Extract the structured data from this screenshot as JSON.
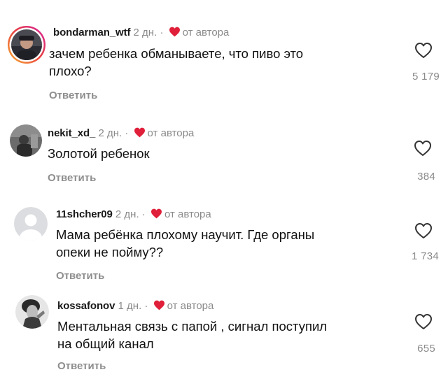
{
  "comments": [
    {
      "username": "bondarman_wtf",
      "time": "2 дн.",
      "separator": "·",
      "author_label": "от автора",
      "text": "зачем ребенка обманываете, что пиво это\nплохо?",
      "reply_label": "Ответить",
      "likes": "5 179"
    },
    {
      "username": "nekit_xd_",
      "time": "2 дн.",
      "separator": "·",
      "author_label": "от автора",
      "text": "Золотой ребенок",
      "reply_label": "Ответить",
      "likes": "384"
    },
    {
      "username": "11shcher09",
      "time": "2 дн.",
      "separator": "·",
      "author_label": "от автора",
      "text": "Мама ребёнка плохому научит.  Где органы\nопеки не пойму??",
      "reply_label": "Ответить",
      "likes": "1 734"
    },
    {
      "username": "kossafonov",
      "time": "1 дн.",
      "separator": "·",
      "author_label": "от автора",
      "text": "Ментальная связь с папой , сигнал поступил\nна общий канал",
      "reply_label": "Ответить",
      "likes": "655"
    }
  ],
  "colors": {
    "author_heart": "#e0203a",
    "muted_text": "#8a8a8a",
    "story_ring_start": "#f9b233",
    "story_ring_end": "#d6249f"
  },
  "icons": {
    "like": "heart-outline-icon",
    "author_like": "heart-filled-icon"
  }
}
